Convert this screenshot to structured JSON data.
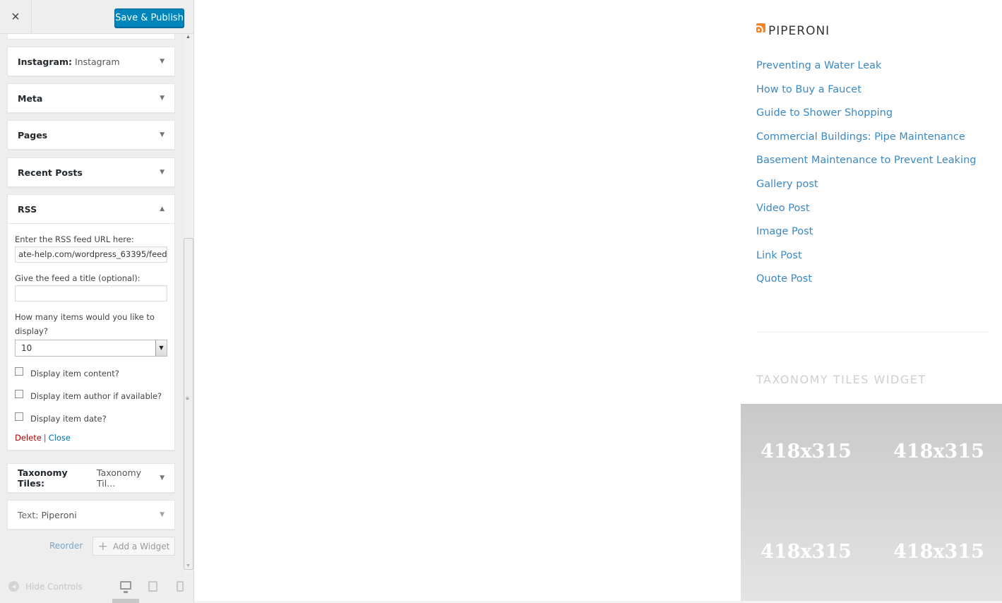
{
  "topbar": {
    "close_icon": "×",
    "save_label": "Save & Publish",
    "save_color": "#0085ba"
  },
  "widgets": [
    {
      "name": "Instagram:",
      "subtitle": "Instagram"
    },
    {
      "name": "Meta",
      "subtitle": ""
    },
    {
      "name": "Pages",
      "subtitle": ""
    },
    {
      "name": "Recent Posts",
      "subtitle": ""
    }
  ],
  "rss_widget": {
    "name": "RSS",
    "url_label": "Enter the RSS feed URL here:",
    "url_value": "ate-help.com/wordpress_63395/feed",
    "title_label": "Give the feed a title (optional):",
    "title_value": "",
    "items_label": "How many items would you like to display?",
    "items_value": "10",
    "checkboxes": [
      {
        "label": "Display item content?",
        "checked": false
      },
      {
        "label": "Display item author if available?",
        "checked": false
      },
      {
        "label": "Display item date?",
        "checked": false
      }
    ],
    "delete_label": "Delete",
    "separator": "|",
    "close_label": "Close"
  },
  "lower_widgets": [
    {
      "name": "Taxonomy Tiles:",
      "subtitle": "Taxonomy Til..."
    },
    {
      "name": "Text:",
      "subtitle": "Piperoni"
    }
  ],
  "sidebar_footer": {
    "reorder_label": "Reorder",
    "add_widget_label": "Add a Widget",
    "hide_controls_label": "Hide Controls",
    "devices": [
      "desktop-icon",
      "tablet-icon",
      "mobile-icon"
    ]
  },
  "preview": {
    "rss_title": "PIPERONI",
    "rss_items": [
      "Preventing a Water Leak",
      "How to Buy a Faucet",
      "Guide to Shower Shopping",
      "Commercial Buildings: Pipe Maintenance",
      "Basement Maintenance to Prevent Leaking",
      "Gallery post",
      "Video Post",
      "Image Post",
      "Link Post",
      "Quote Post"
    ],
    "taxonomy_title": "TAXONOMY TILES WIDGET",
    "tiles": [
      "418x315",
      "418x315",
      "418x315",
      "418x315"
    ],
    "link_color": "#3b88c3"
  }
}
